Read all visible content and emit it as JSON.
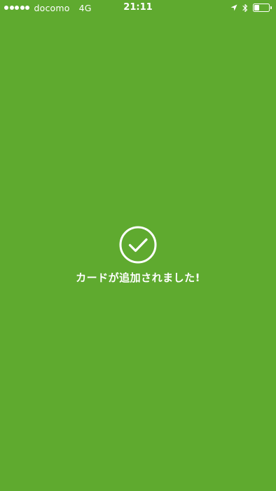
{
  "status_bar": {
    "signal_bars": 5,
    "carrier": "docomo",
    "network": "4G",
    "time": "21:11",
    "icons": [
      "location-arrow-icon",
      "bluetooth-icon",
      "battery-icon"
    ],
    "battery_level": 0.35
  },
  "confirmation": {
    "icon": "check-circle-icon",
    "message": "カードが追加されました!"
  },
  "colors": {
    "background": "#5faa2f",
    "foreground": "#ffffff"
  }
}
